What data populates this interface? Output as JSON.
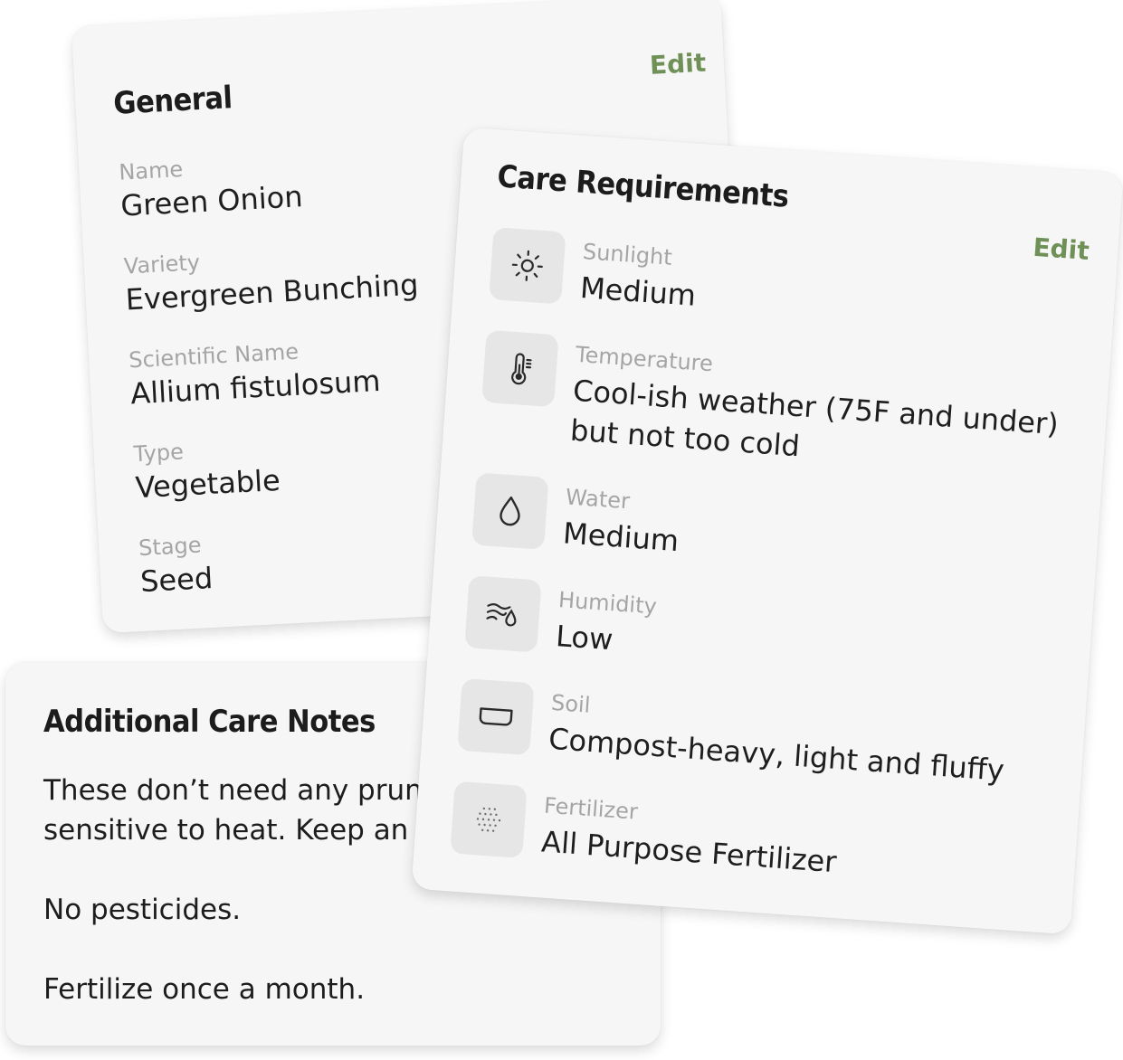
{
  "general": {
    "title": "General",
    "edit_label": "Edit",
    "fields": [
      {
        "label": "Name",
        "value": "Green Onion"
      },
      {
        "label": "Variety",
        "value": "Evergreen Bunching"
      },
      {
        "label": "Scientific Name",
        "value": "Allium fistulosum"
      },
      {
        "label": "Type",
        "value": "Vegetable"
      },
      {
        "label": "Stage",
        "value": "Seed"
      }
    ]
  },
  "care": {
    "title": "Care Requirements",
    "edit_label": "Edit",
    "items": [
      {
        "icon": "sun-icon",
        "label": "Sunlight",
        "value": "Medium"
      },
      {
        "icon": "thermometer-icon",
        "label": "Temperature",
        "value": "Cool-ish weather (75F and under) but not too cold"
      },
      {
        "icon": "water-drop-icon",
        "label": "Water",
        "value": "Medium"
      },
      {
        "icon": "humidity-icon",
        "label": "Humidity",
        "value": "Low"
      },
      {
        "icon": "soil-pot-icon",
        "label": "Soil",
        "value": "Compost-heavy, light and fluffy"
      },
      {
        "icon": "fertilizer-dots-icon",
        "label": "Fertilizer",
        "value": "All Purpose Fertilizer"
      }
    ]
  },
  "notes": {
    "title": "Additional Care Notes",
    "line1": "These don’t need any pruning, bu",
    "line2": "sensitive to heat. Keep an eye o",
    "line3": "No pesticides.",
    "line4": "Fertilize once a month."
  },
  "colors": {
    "accent": "#6f9157",
    "card_bg": "#f6f6f6",
    "icon_bg": "#e6e6e6",
    "label": "#a5a5a5"
  }
}
